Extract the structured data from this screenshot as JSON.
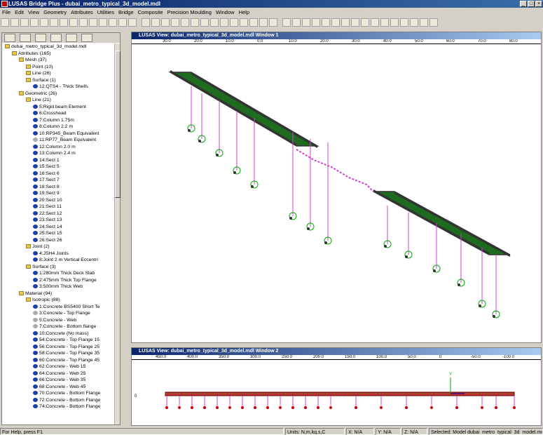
{
  "window": {
    "title": "LUSAS Bridge Plus - dubai_metro_typical_3d_model.mdl"
  },
  "menu": [
    "File",
    "Edit",
    "View",
    "Geometry",
    "Attributes",
    "Utilities",
    "Bridge",
    "Composite",
    "Precision Moulding",
    "Window",
    "Help"
  ],
  "tree": [
    {
      "t": "dubai_metro_typical_3d_model.mdl",
      "d": 0,
      "i": "folder"
    },
    {
      "t": "Attributes (165)",
      "d": 1,
      "i": "folder"
    },
    {
      "t": "Mesh (37)",
      "d": 2,
      "i": "folder"
    },
    {
      "t": "Point (10)",
      "d": 3,
      "i": "folder"
    },
    {
      "t": "Line (26)",
      "d": 3,
      "i": "folder"
    },
    {
      "t": "Surface (1)",
      "d": 3,
      "i": "folder"
    },
    {
      "t": "12:QTS4 - Thick Shells",
      "d": 4,
      "i": "attr"
    },
    {
      "t": "Geometric (26)",
      "d": 2,
      "i": "folder"
    },
    {
      "t": "Line (21)",
      "d": 3,
      "i": "folder"
    },
    {
      "t": "5:Rigid beam Element",
      "d": 4,
      "i": "attr"
    },
    {
      "t": "6:Crosshead",
      "d": 4,
      "i": "attr"
    },
    {
      "t": "7:Column 1.75m",
      "d": 4,
      "i": "attr"
    },
    {
      "t": "8:Column 2.2 m",
      "d": 4,
      "i": "attr"
    },
    {
      "t": "10:RP345_Beam Equivalent",
      "d": 4,
      "i": "attr"
    },
    {
      "t": "11:RP77_Beam Equivalent",
      "d": 4,
      "i": "attrg"
    },
    {
      "t": "12:Column 2.0 m",
      "d": 4,
      "i": "attr"
    },
    {
      "t": "13:Column 2.4 m",
      "d": 4,
      "i": "attr"
    },
    {
      "t": "14:Sect 1",
      "d": 4,
      "i": "attr"
    },
    {
      "t": "15:Sect 5",
      "d": 4,
      "i": "attr"
    },
    {
      "t": "16:Sect 6",
      "d": 4,
      "i": "attr"
    },
    {
      "t": "17:Sect 7",
      "d": 4,
      "i": "attr"
    },
    {
      "t": "18:Sect 8",
      "d": 4,
      "i": "attr"
    },
    {
      "t": "19:Sect 9",
      "d": 4,
      "i": "attr"
    },
    {
      "t": "20:Sect 10",
      "d": 4,
      "i": "attr"
    },
    {
      "t": "21:Sect 11",
      "d": 4,
      "i": "attr"
    },
    {
      "t": "22:Sect 12",
      "d": 4,
      "i": "attr"
    },
    {
      "t": "23:Sect 13",
      "d": 4,
      "i": "attr"
    },
    {
      "t": "24:Sect 14",
      "d": 4,
      "i": "attr"
    },
    {
      "t": "25:Sect 15",
      "d": 4,
      "i": "attr"
    },
    {
      "t": "26:Sect 26",
      "d": 4,
      "i": "attr"
    },
    {
      "t": "Joint (2)",
      "d": 3,
      "i": "folder"
    },
    {
      "t": "4:JSH4 Joints",
      "d": 4,
      "i": "attr"
    },
    {
      "t": "8:Joint 2 m Vertical Eccentri",
      "d": 4,
      "i": "attr"
    },
    {
      "t": "Surface (3)",
      "d": 3,
      "i": "folder"
    },
    {
      "t": "1:280mm Thick Deck Slab",
      "d": 4,
      "i": "attr"
    },
    {
      "t": "2:475mm Thick Top Flange",
      "d": 4,
      "i": "attr"
    },
    {
      "t": "3:500mm Thick Web",
      "d": 4,
      "i": "attr"
    },
    {
      "t": "Material (94)",
      "d": 2,
      "i": "folder"
    },
    {
      "t": "Isotropic (88)",
      "d": 3,
      "i": "folder"
    },
    {
      "t": "1:Concrete BS5400 Short Te",
      "d": 4,
      "i": "attr"
    },
    {
      "t": "3:Concrete - Top Flange",
      "d": 4,
      "i": "attrg"
    },
    {
      "t": "5:Concrete - Web",
      "d": 4,
      "i": "attrg"
    },
    {
      "t": "7:Concrete - Bottom flange",
      "d": 4,
      "i": "attrg"
    },
    {
      "t": "10:Concrete (No mass)",
      "d": 4,
      "i": "attr"
    },
    {
      "t": "54:Concrete - Top Flange 15",
      "d": 4,
      "i": "attr"
    },
    {
      "t": "56:Concrete - Top Flange 25",
      "d": 4,
      "i": "attr"
    },
    {
      "t": "58:Concrete - Top Flange 35",
      "d": 4,
      "i": "attr"
    },
    {
      "t": "60:Concrete - Top Flange 45",
      "d": 4,
      "i": "attr"
    },
    {
      "t": "62:Concrete - Web 15",
      "d": 4,
      "i": "attr"
    },
    {
      "t": "64:Concrete - Web 25",
      "d": 4,
      "i": "attr"
    },
    {
      "t": "66:Concrete - Web 35",
      "d": 4,
      "i": "attr"
    },
    {
      "t": "68:Concrete - Web 45",
      "d": 4,
      "i": "attr"
    },
    {
      "t": "70:Concrete - Bottom Flange",
      "d": 4,
      "i": "attr"
    },
    {
      "t": "72:Concrete - Bottom Flange",
      "d": 4,
      "i": "attr"
    },
    {
      "t": "74:Concrete - Bottom Flange",
      "d": 4,
      "i": "attr"
    }
  ],
  "view1": {
    "title": "LUSAS View: dubai_metro_typical_3d_model.mdl Window 1",
    "ticks": [
      "30.0",
      "20.0",
      "10.0",
      "0.0",
      "10.0",
      "20.0",
      "30.0",
      "40.0",
      "50.0",
      "60.0",
      "70.0",
      "80.0",
      "90.0"
    ]
  },
  "view2": {
    "title": "LUSAS View: dubai_metro_typical_3d_model.mdl Window 2",
    "ticks": [
      "450.0",
      "400.0",
      "350.0",
      "300.0",
      "250.0",
      "200.0",
      "150.0",
      "100.0",
      "50.0",
      "0",
      "-50.0",
      "-100.0"
    ],
    "yaxis": "Y",
    "zero": "0"
  },
  "status": {
    "help": "For Help, press F1",
    "units": "Units: N,m,kg,s,C",
    "x": "X: N/A",
    "y": "Y: N/A",
    "z": "Z: N/A",
    "selected": "Selected: Model dubai_metro_typical_3d_model.mdl"
  }
}
